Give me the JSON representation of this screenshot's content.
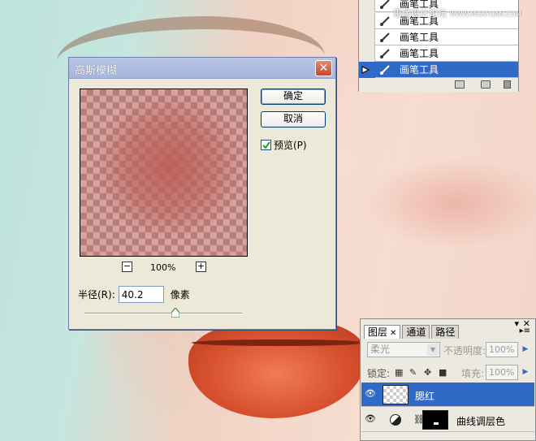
{
  "watermark": {
    "main": "思缘设计论坛",
    "sub": "WWW.MISSYUAN.COM"
  },
  "history": {
    "items": [
      {
        "label": "画笔工具",
        "selected": false
      },
      {
        "label": "画笔工具",
        "selected": false
      },
      {
        "label": "画笔工具",
        "selected": false
      },
      {
        "label": "画笔工具",
        "selected": false
      },
      {
        "label": "画笔工具",
        "selected": true
      }
    ],
    "icons": [
      "new-document-icon",
      "snapshot-icon",
      "trash-icon"
    ]
  },
  "dialog": {
    "title": "高斯模糊",
    "ok_label": "确定",
    "cancel_label": "取消",
    "preview_label": "预览(P)",
    "preview_checked": true,
    "zoom_minus": "−",
    "zoom_plus": "+",
    "zoom_level": "100%",
    "radius_label": "半径(R):",
    "radius_value": "40.2",
    "radius_unit": "像素"
  },
  "layers": {
    "tabs": [
      {
        "label": "图层",
        "active": true
      },
      {
        "label": "通道",
        "active": false
      },
      {
        "label": "路径",
        "active": false
      }
    ],
    "blend_mode": "柔光",
    "opacity_label": "不透明度:",
    "opacity_value": "100%",
    "lock_label": "锁定:",
    "fill_label": "填充:",
    "fill_value": "100%",
    "rows": [
      {
        "name": "腮红",
        "selected": true
      },
      {
        "name": "曲线调层色",
        "selected": false
      }
    ]
  },
  "colors": {
    "selection": "#3169c6",
    "dialog_bg": "#ece9d8",
    "lips": "#d8512e"
  }
}
